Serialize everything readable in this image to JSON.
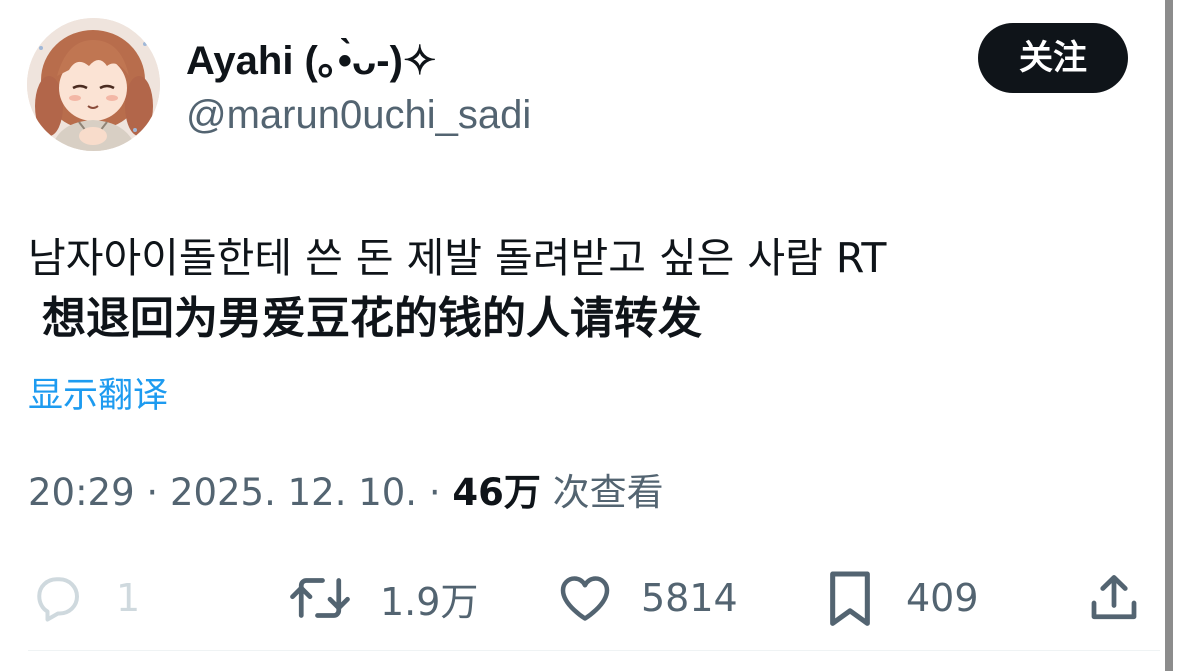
{
  "user": {
    "display_name": "Ayahi (｡•̀ᴗ-)✧",
    "handle": "@marun0uchi_sadi"
  },
  "follow_label": "关注",
  "tweet": {
    "text_line_1": "남자아이돌한테 쓴 돈 제발 돌려받고 싶은 사람 RT",
    "text_line_2": "想退回为男爱豆花的钱的人请转发"
  },
  "translate_label": "显示翻译",
  "meta": {
    "time": "20:29",
    "date": "2025. 12. 10.",
    "separator": "·",
    "views_count": "46万",
    "views_label": "次查看"
  },
  "actions": {
    "reply_count": "1",
    "retweet_count": "1.9万",
    "like_count": "5814",
    "bookmark_count": "409"
  },
  "icons": {
    "reply": "reply-bubble-icon",
    "retweet": "retweet-icon",
    "like": "heart-icon",
    "bookmark": "bookmark-icon",
    "share": "share-icon"
  },
  "colors": {
    "text": "#0f1419",
    "secondary": "#536471",
    "link": "#1d9bf0",
    "follow_bg": "#0f1419",
    "disabled": "#cfd9de"
  }
}
